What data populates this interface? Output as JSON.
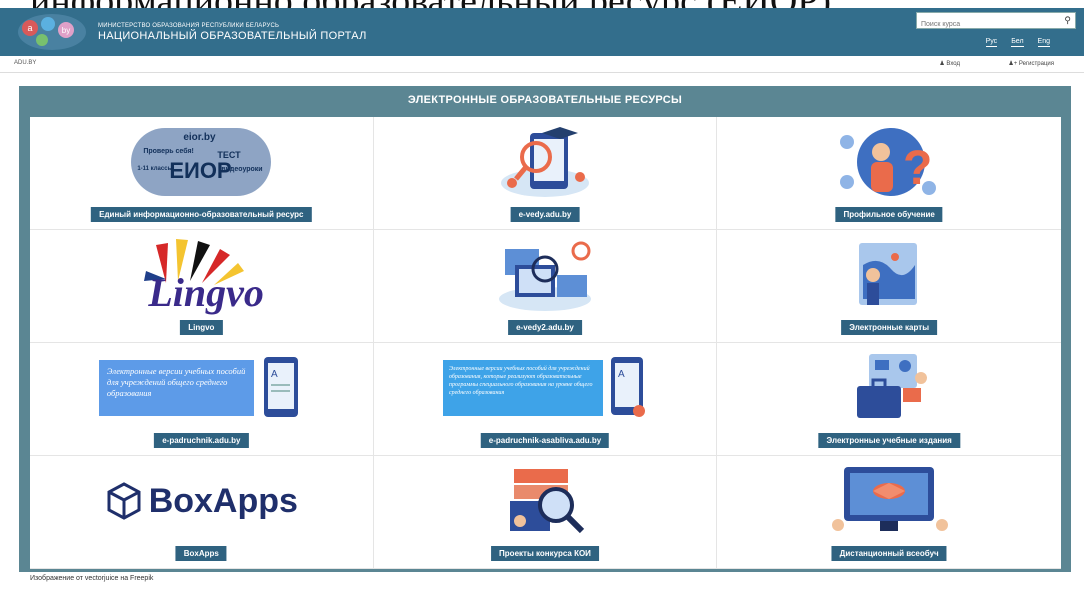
{
  "top_caption": "информационно образовательный ресурс (ЕИОР)",
  "header": {
    "subtitle": "МИНИСТЕРСТВО ОБРАЗОВАНИЯ РЕСПУБЛИКИ БЕЛАРУСЬ",
    "title": "НАЦИОНАЛЬНЫЙ ОБРАЗОВАТЕЛЬНЫЙ ПОРТАЛ",
    "search_placeholder": "Поиск курса",
    "languages": [
      "Рус",
      "Бел",
      "Eng"
    ]
  },
  "subbar": {
    "site": "ADU.BY",
    "login": "Вход",
    "register": "Регистрация"
  },
  "panel": {
    "title": "ЭЛЕКТРОННЫЕ ОБРАЗОВАТЕЛЬНЫЕ РЕСУРСЫ",
    "items": [
      {
        "label": "Единый информационно-образовательный ресурс"
      },
      {
        "label": "e-vedy.adu.by"
      },
      {
        "label": "Профильное обучение"
      },
      {
        "label": "Lingvo"
      },
      {
        "label": "e-vedy2.adu.by"
      },
      {
        "label": "Электронные карты"
      },
      {
        "label": "e-padruchnik.adu.by"
      },
      {
        "label": "e-padruchnik-asabliva.adu.by"
      },
      {
        "label": "Электронные учебные издания"
      },
      {
        "label": "BoxApps"
      },
      {
        "label": "Проекты конкурса КОИ"
      },
      {
        "label": "Дистанционный всеобуч"
      }
    ]
  },
  "art_text": {
    "eior_site": "eior.by",
    "eior_name": "ЕИОР",
    "eior_words": [
      "Проверь себя!",
      "ТЕСТ",
      "1-11 классы",
      "видеоуроки"
    ],
    "lingvo_word": "Lingvo",
    "padruchnik_text": "Электронные версии учебных пособий для учреждений общего среднего образования",
    "asabliva_text": "Электронные версии учебных пособий для учреждений образования, которые реализуют образовательные программы специального образования на уровне общего среднего образования",
    "boxapps_word": "BoxApps"
  },
  "footer_note": "Изображение от vectorjuice на Freepik",
  "colors": {
    "header": "#336e8c",
    "panel": "#5b8693",
    "label": "#2f6280"
  }
}
